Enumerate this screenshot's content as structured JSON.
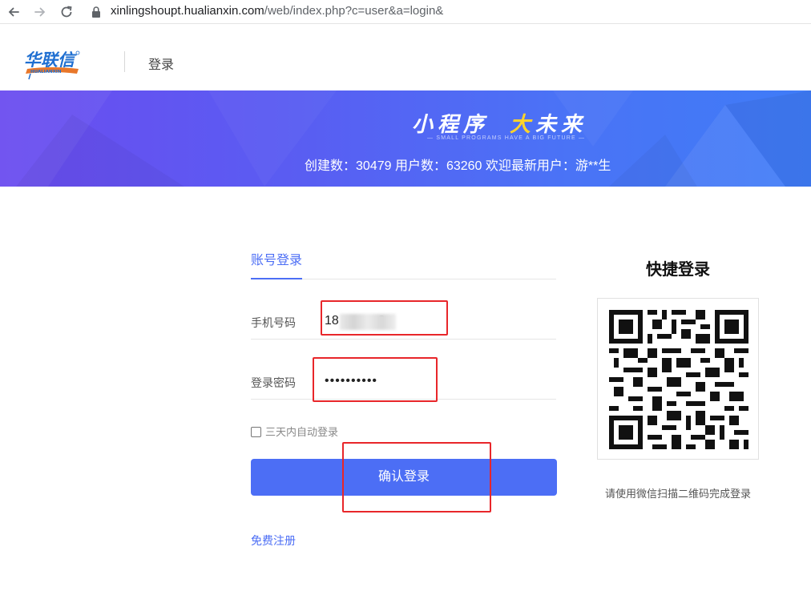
{
  "browser": {
    "url_host": "xinlingshoupt.hualianxin.com",
    "url_path": "/web/index.php?c=user&a=login&"
  },
  "header": {
    "logo_text": "华联信",
    "logo_sub": "HUALIANXIN",
    "title": "登录"
  },
  "banner": {
    "slogan_part1": "小程序",
    "slogan_part2_highlight": "大",
    "slogan_part2_rest": "未来",
    "slogan_sub": "— SMALL PROGRAMS HAVE A BIG FUTURE —",
    "stats": "创建数：30479 用户数：63260 欢迎最新用户：游**生"
  },
  "login": {
    "tab_label": "账号登录",
    "phone_label": "手机号码",
    "phone_value": "18           3",
    "password_label": "登录密码",
    "password_value": "••••••••••",
    "remember_label": "三天内自动登录",
    "submit_label": "确认登录",
    "register_label": "免费注册"
  },
  "quick_login": {
    "title": "快捷登录",
    "hint": "请使用微信扫描二维码完成登录"
  },
  "colors": {
    "accent": "#4c6ef5",
    "banner_start": "#6b4cf0",
    "banner_end": "#3f7cf7",
    "highlight": "#ffd42a",
    "annotation": "#e8262a"
  }
}
